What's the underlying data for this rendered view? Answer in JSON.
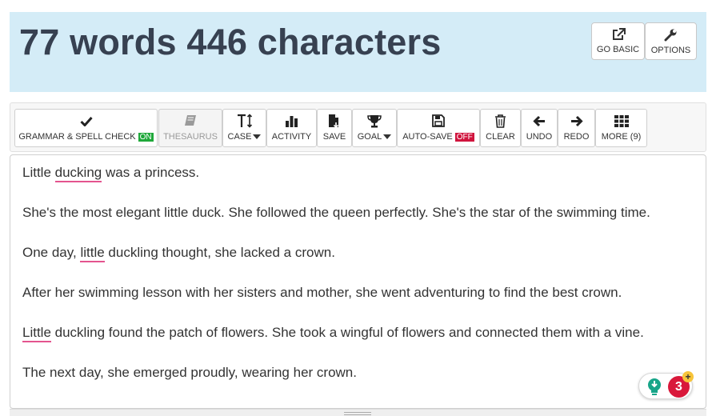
{
  "header": {
    "counter": "77 words 446 characters",
    "go_basic": "GO BASIC",
    "options": "OPTIONS"
  },
  "toolbar": {
    "grammar": {
      "label": "GRAMMAR & SPELL CHECK",
      "badge": "ON",
      "icon": "check-icon"
    },
    "thesaurus": {
      "label": "THESAURUS",
      "icon": "book-icon",
      "disabled": true
    },
    "case": {
      "label": "CASE",
      "icon": "text-height-icon"
    },
    "activity": {
      "label": "ACTIVITY",
      "icon": "bar-chart-icon"
    },
    "save": {
      "label": "SAVE",
      "icon": "save-file-icon"
    },
    "goal": {
      "label": "GOAL",
      "icon": "trophy-icon"
    },
    "autosave": {
      "label": "AUTO-SAVE",
      "badge": "OFF",
      "icon": "floppy-icon"
    },
    "clear": {
      "label": "CLEAR",
      "icon": "trash-icon"
    },
    "undo": {
      "label": "UNDO",
      "icon": "arrow-left-icon"
    },
    "redo": {
      "label": "REDO",
      "icon": "arrow-right-icon"
    },
    "more": {
      "label": "MORE (9)",
      "icon": "grid-icon"
    }
  },
  "editor": {
    "p1": {
      "err": "ducking",
      "pre": "Little ",
      "post": " was a princess."
    },
    "p2": "She's the most elegant little duck. She followed the queen perfectly. She's the star of the swimming time.",
    "p3": {
      "pre": "One day, ",
      "err": "little",
      "post": " duckling thought, she lacked a crown."
    },
    "p4": "After her swimming lesson with her sisters and mother, she went adventuring to find the best crown.",
    "p5": {
      "err": "Little",
      "post": " duckling found the patch of flowers. She took a wingful of flowers and connected them with a vine."
    },
    "p6": "The next day, she emerged proudly, wearing her crown."
  },
  "grammar_badge": {
    "count": "3",
    "plus": "+"
  },
  "colors": {
    "header_bg": "#d4ecf7",
    "on_green": "#1fa83a",
    "off_red": "#d0143d",
    "error_underline": "#e4548f"
  }
}
